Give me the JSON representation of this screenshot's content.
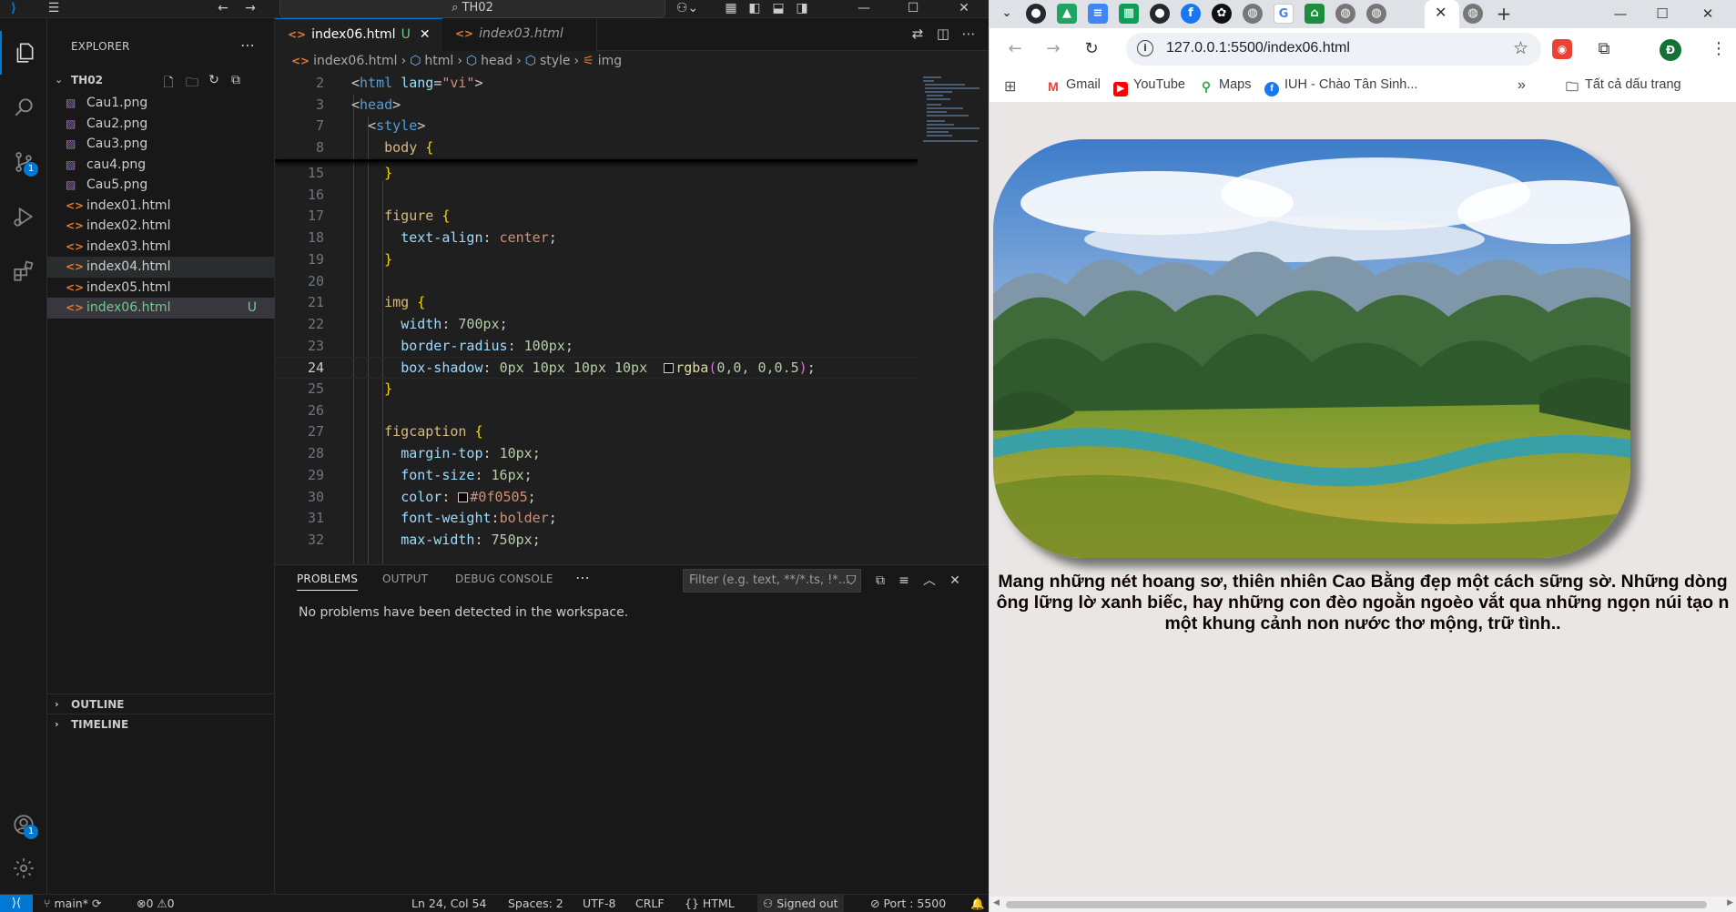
{
  "vscode": {
    "command_center": "TH02",
    "explorer": {
      "title": "EXPLORER",
      "folder": "TH02",
      "files": [
        {
          "name": "Cau1.png",
          "kind": "image"
        },
        {
          "name": "Cau2.png",
          "kind": "image"
        },
        {
          "name": "Cau3.png",
          "kind": "image"
        },
        {
          "name": "cau4.png",
          "kind": "image"
        },
        {
          "name": "Cau5.png",
          "kind": "image"
        },
        {
          "name": "index01.html",
          "kind": "html"
        },
        {
          "name": "index02.html",
          "kind": "html"
        },
        {
          "name": "index03.html",
          "kind": "html"
        },
        {
          "name": "index04.html",
          "kind": "html"
        },
        {
          "name": "index05.html",
          "kind": "html"
        },
        {
          "name": "index06.html",
          "kind": "html",
          "status": "U"
        }
      ],
      "outline": "OUTLINE",
      "timeline": "TIMELINE"
    },
    "activity_badges": {
      "scm": "1",
      "accounts": "1"
    },
    "tabs": [
      {
        "label": "index06.html",
        "status": "U",
        "active": true
      },
      {
        "label": "index03.html",
        "active": false
      }
    ],
    "breadcrumbs": [
      "index06.html",
      "html",
      "head",
      "style",
      "img"
    ],
    "code": {
      "lines": [
        {
          "n": "2"
        },
        {
          "n": "3"
        },
        {
          "n": "7"
        },
        {
          "n": "8"
        },
        {
          "n": "15"
        },
        {
          "n": "16"
        },
        {
          "n": "17"
        },
        {
          "n": "18"
        },
        {
          "n": "19"
        },
        {
          "n": "20"
        },
        {
          "n": "21"
        },
        {
          "n": "22"
        },
        {
          "n": "23"
        },
        {
          "n": "24"
        },
        {
          "n": "25"
        },
        {
          "n": "26"
        },
        {
          "n": "27"
        },
        {
          "n": "28"
        },
        {
          "n": "29"
        },
        {
          "n": "30"
        },
        {
          "n": "31"
        },
        {
          "n": "32"
        }
      ],
      "text": {
        "l2_tag": "html",
        "l2_attr": "lang",
        "l2_val": "\"vi\"",
        "l3_tag": "head",
        "l7_tag": "style",
        "l8_sel": "body",
        "l17_sel": "figure",
        "l18_prop": "text-align",
        "l18_val": "center",
        "l21_sel": "img",
        "l22_prop": "width",
        "l22_val": "700px",
        "l23_prop": "border-radius",
        "l23_val": "100px",
        "l24_prop": "box-shadow",
        "l24_val": "0px 10px 10px 10px",
        "l24_fn": "rgba",
        "l24_args": "0,0, 0,0.5",
        "l27_sel": "figcaption",
        "l28_prop": "margin-top",
        "l28_val": "10px",
        "l29_prop": "font-size",
        "l29_val": "16px",
        "l30_prop": "color",
        "l30_val": "#0f0505",
        "l31_prop": "font-weight",
        "l31_val": "bolder",
        "l32_prop": "max-width",
        "l32_val": "750px"
      },
      "current_line": "24"
    },
    "panel": {
      "tabs": [
        "PROBLEMS",
        "OUTPUT",
        "DEBUG CONSOLE"
      ],
      "active_tab": "PROBLEMS",
      "filter_placeholder": "Filter (e.g. text, **/*.ts, !*...",
      "message": "No problems have been detected in the workspace."
    },
    "status": {
      "branch": "main*",
      "errors": "0",
      "warnings": "0",
      "position": "Ln 24, Col 54",
      "spaces": "Spaces: 2",
      "encoding": "UTF-8",
      "eol": "CRLF",
      "language": "HTML",
      "account": "Signed out",
      "port": "Port : 5500"
    }
  },
  "chrome": {
    "url": "127.0.0.1:5500/index06.html",
    "profile_initial": "Đ",
    "bookmarks": [
      "Gmail",
      "YouTube",
      "Maps",
      "IUH - Chào Tân Sinh...",
      "Tất cả dấu trang"
    ],
    "tab_icons": [
      "github",
      "google-drive",
      "google-docs",
      "google-sheets",
      "github",
      "facebook",
      "openai",
      "globe",
      "google",
      "home",
      "globe",
      "globe",
      "globe",
      "globe"
    ],
    "page": {
      "caption_lines": [
        "Mang những nét hoang sơ, thiên nhiên Cao Bằng đẹp một cách sững sờ. Những dòng",
        "ông lững lờ xanh biếc, hay những con đèo ngoằn ngoèo vắt qua những ngọn núi tạo n",
        "một khung cảnh non nước thơ mộng, trữ tình.."
      ]
    }
  }
}
